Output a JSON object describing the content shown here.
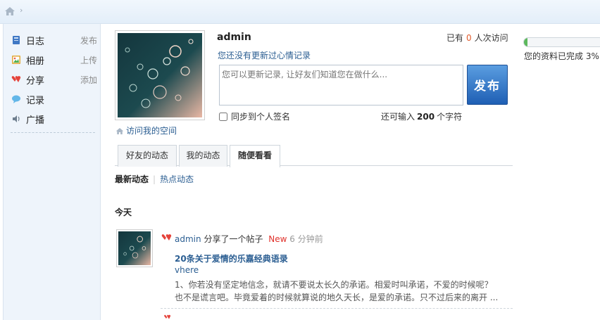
{
  "breadcrumb": {
    "separator": "›"
  },
  "sidebar": {
    "items": [
      {
        "label": "日志",
        "action": "发布",
        "icon": "diary-icon"
      },
      {
        "label": "相册",
        "action": "上传",
        "icon": "album-icon"
      },
      {
        "label": "分享",
        "action": "添加",
        "icon": "share-icon"
      },
      {
        "label": "记录",
        "action": "",
        "icon": "record-icon"
      },
      {
        "label": "广播",
        "action": "",
        "icon": "broadcast-icon"
      }
    ]
  },
  "profile": {
    "username": "admin",
    "visits_prefix": "已有",
    "visits_count": "0",
    "visits_suffix": "人次访问",
    "mood_link": "您还没有更新过心情记录",
    "visit_space": "访问我的空间",
    "completion_text": "您的资料已完成 3%",
    "completion_fraction": 0.03
  },
  "composer": {
    "placeholder": "您可以更新记录, 让好友们知道您在做什么...",
    "publish_label": "发布",
    "sync_label": "同步到个人签名",
    "remaining_prefix": "还可输入",
    "remaining_count": "200",
    "remaining_suffix": "个字符"
  },
  "tabs": [
    {
      "label": "好友的动态",
      "active": false
    },
    {
      "label": "我的动态",
      "active": false
    },
    {
      "label": "随便看看",
      "active": true
    }
  ],
  "subtabs": {
    "active": "最新动态",
    "other": "热点动态"
  },
  "feed": {
    "day": "今天",
    "items": [
      {
        "user": "admin",
        "action": "分享了一个帖子",
        "badge": "New",
        "time": "6 分钟前",
        "title": "20条关于爱情的乐嘉经典语录",
        "author": "vhere",
        "line1": "1、你若没有坚定地信念，就请不要说太长久的承诺。相爱时叫承诺，不爱的时候呢？",
        "line2": "也不是谎言吧。毕竟爱着的时候就算说的地久天长，是爱的承诺。只不过后来的离开 ..."
      }
    ]
  },
  "colors": {
    "link": "#2b5e92",
    "accent": "#1f5fb4",
    "new_badge": "#e0312b",
    "visit_count": "#e05a2b",
    "progress": "#5cb85c"
  }
}
